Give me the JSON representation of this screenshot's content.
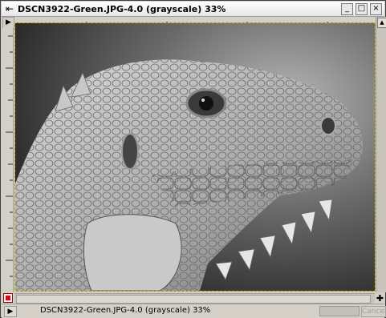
{
  "window": {
    "title": "DSCN3922-Green.JPG-4.0 (grayscale) 33%",
    "menu_icon": "⇤",
    "controls": {
      "minimize": "_",
      "maximize": "□",
      "close": "×"
    }
  },
  "rulers": {
    "corner_glyph": "▶"
  },
  "canvas": {
    "image_description_icon": "image-canvas"
  },
  "scroll": {
    "up_glyph": "▲",
    "nav_glyph": "✚"
  },
  "status": {
    "text": "DSCN3922-Green.JPG-4.0 (grayscale) 33%",
    "arrow_glyph": "▶",
    "cancel_label": "Cancel"
  },
  "colors": {
    "canvas_border": "#d8c400",
    "quickmask": "#e00000"
  }
}
